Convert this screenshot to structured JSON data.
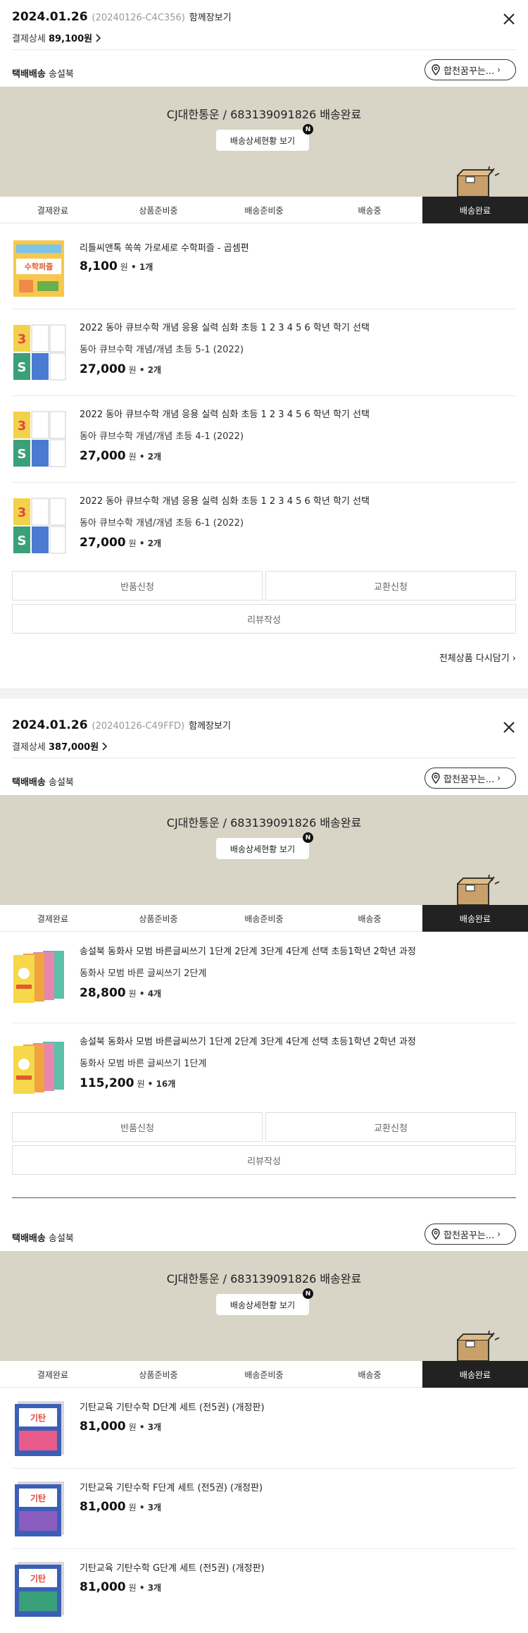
{
  "orders": [
    {
      "date": "2024.01.26",
      "code": "(20240126-C4C356)",
      "share_label": "함께장보기",
      "pay_label": "결제상세",
      "pay_amount": "89,100원",
      "shipments": [
        {
          "method": "택배배송",
          "seller": "송설북",
          "place_label": "합천꿈꾸는...",
          "tracking": "CJ대한통운 / 683139091826 배송완료",
          "track_btn": "배송상세현황 보기",
          "badge": "N",
          "steps": [
            "결제완료",
            "상품준비중",
            "배송준비중",
            "배송중",
            "배송완료"
          ],
          "active_step": 4,
          "items": [
            {
              "name": "리틀씨앤톡 쏙쏙 가로세로 수학퍼즐 - 곱셈편",
              "option": "",
              "price": "8,100",
              "unit": "원",
              "qty": "1개",
              "thumb": "puzzle-book"
            },
            {
              "name": "2022 동아 큐브수학 개념 응용 실력 심화 초등 1 2 3 4 5 6 학년 학기 선택",
              "option": "동아 큐브수학 개념/개념 초등 5-1 (2022)",
              "price": "27,000",
              "unit": "원",
              "qty": "2개",
              "thumb": "cube-math"
            },
            {
              "name": "2022 동아 큐브수학 개념 응용 실력 심화 초등 1 2 3 4 5 6 학년 학기 선택",
              "option": "동아 큐브수학 개념/개념 초등 4-1 (2022)",
              "price": "27,000",
              "unit": "원",
              "qty": "2개",
              "thumb": "cube-math"
            },
            {
              "name": "2022 동아 큐브수학 개념 응용 실력 심화 초등 1 2 3 4 5 6 학년 학기 선택",
              "option": "동아 큐브수학 개념/개념 초등 6-1 (2022)",
              "price": "27,000",
              "unit": "원",
              "qty": "2개",
              "thumb": "cube-math"
            }
          ],
          "return_label": "반품신청",
          "exchange_label": "교환신청",
          "review_label": "리뷰작성"
        }
      ],
      "reorder_label": "전체상품 다시담기"
    },
    {
      "date": "2024.01.26",
      "code": "(20240126-C49FFD)",
      "share_label": "함께장보기",
      "pay_label": "결제상세",
      "pay_amount": "387,000원",
      "shipments": [
        {
          "method": "택배배송",
          "seller": "송설북",
          "place_label": "합천꿈꾸는...",
          "tracking": "CJ대한통운 / 683139091826 배송완료",
          "track_btn": "배송상세현황 보기",
          "badge": "N",
          "steps": [
            "결제완료",
            "상품준비중",
            "배송준비중",
            "배송중",
            "배송완료"
          ],
          "active_step": 4,
          "items": [
            {
              "name": "송설북 동화사 모범 바른글씨쓰기 1단계 2단계 3단계 4단계 선택 초등1학년 2학년 과정",
              "option": "동화사 모범 바른 글씨쓰기 2단계",
              "price": "28,800",
              "unit": "원",
              "qty": "4개",
              "thumb": "handwriting-set"
            },
            {
              "name": "송설북 동화사 모범 바른글씨쓰기 1단계 2단계 3단계 4단계 선택 초등1학년 2학년 과정",
              "option": "동화사 모범 바른 글씨쓰기 1단계",
              "price": "115,200",
              "unit": "원",
              "qty": "16개",
              "thumb": "handwriting-set"
            }
          ],
          "return_label": "반품신청",
          "exchange_label": "교환신청",
          "review_label": "리뷰작성"
        },
        {
          "method": "택배배송",
          "seller": "송설북",
          "place_label": "합천꿈꾸는...",
          "tracking": "CJ대한통운 / 683139091826 배송완료",
          "track_btn": "배송상세현황 보기",
          "badge": "N",
          "steps": [
            "결제완료",
            "상품준비중",
            "배송준비중",
            "배송중",
            "배송완료"
          ],
          "active_step": 4,
          "items": [
            {
              "name": "기탄교육 기탄수학 D단계 세트 (전5권) (개정판)",
              "option": "",
              "price": "81,000",
              "unit": "원",
              "qty": "3개",
              "thumb": "gitan-set"
            },
            {
              "name": "기탄교육 기탄수학 F단계 세트 (전5권) (개정판)",
              "option": "",
              "price": "81,000",
              "unit": "원",
              "qty": "3개",
              "thumb": "gitan-set"
            },
            {
              "name": "기탄교육 기탄수학 G단계 세트 (전5권) (개정판)",
              "option": "",
              "price": "81,000",
              "unit": "원",
              "qty": "3개",
              "thumb": "gitan-set"
            }
          ]
        }
      ]
    }
  ],
  "colors": {
    "status_panel": "#d8d4c6",
    "active_step": "#222222",
    "accent_box": "#c9a06a"
  }
}
